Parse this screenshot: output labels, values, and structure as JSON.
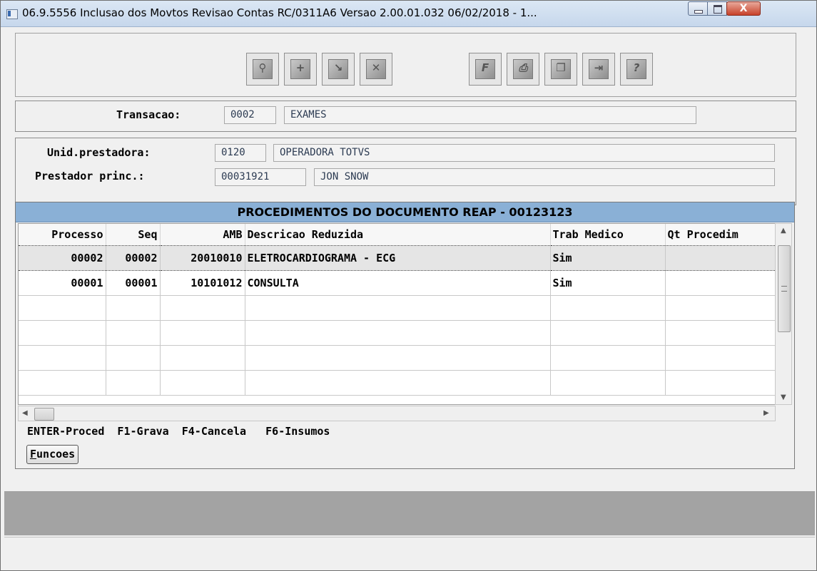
{
  "window": {
    "title": "06.9.5556  Inclusao  dos Movtos Revisao Contas RC/0311A6 Versao 2.00.01.032 06/02/2018 - 1...",
    "close_label": "X"
  },
  "toolbar": {
    "buttons": [
      {
        "name": "search-icon",
        "glyph": "⚲"
      },
      {
        "name": "add-icon",
        "glyph": "+"
      },
      {
        "name": "edit-icon",
        "glyph": "↘"
      },
      {
        "name": "delete-icon",
        "glyph": "✕"
      },
      {
        "name": "filter-icon",
        "glyph": "F"
      },
      {
        "name": "print-icon",
        "glyph": "⎙"
      },
      {
        "name": "copy-icon",
        "glyph": "❐"
      },
      {
        "name": "exit-icon",
        "glyph": "⇥"
      },
      {
        "name": "help-icon",
        "glyph": "?"
      }
    ]
  },
  "transacao": {
    "label": "Transacao:",
    "code": "0002",
    "desc": "EXAMES"
  },
  "unid": {
    "label": "Unid.prestadora:",
    "code": "0120",
    "desc": "OPERADORA TOTVS"
  },
  "prestador": {
    "label": "Prestador princ.:",
    "code": "00031921",
    "desc": "JON SNOW"
  },
  "dialog": {
    "title": "PROCEDIMENTOS DO DOCUMENTO REAP - 00123123",
    "columns": [
      "Processo",
      "Seq",
      "AMB",
      "Descricao Reduzida",
      "Trab Medico",
      "Qt Procedim"
    ],
    "rows": [
      [
        "00002",
        "00002",
        "20010010",
        "ELETROCARDIOGRAMA - ECG",
        "Sim",
        ""
      ],
      [
        "00001",
        "00001",
        "10101012",
        "CONSULTA",
        "Sim",
        ""
      ]
    ],
    "keys": "ENTER-Proced  F1-Grava  F4-Cancela   F6-Insumos",
    "funcoes_hotkey": "F",
    "funcoes_rest": "uncoes"
  }
}
